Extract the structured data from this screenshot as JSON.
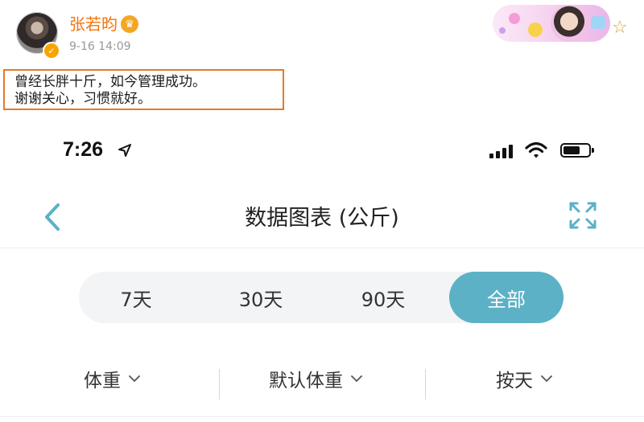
{
  "post": {
    "username": "张若昀",
    "timestamp": "9-16 14:09",
    "text_lines": [
      "曾经长胖十斤，如今管理成功。",
      "谢谢关心，习惯就好。"
    ]
  },
  "status_bar": {
    "time": "7:26"
  },
  "nav": {
    "title": "数据图表 (公斤)"
  },
  "range_tabs": [
    {
      "label": "7天",
      "active": false
    },
    {
      "label": "30天",
      "active": false
    },
    {
      "label": "90天",
      "active": false
    },
    {
      "label": "全部",
      "active": true
    }
  ],
  "filters": [
    {
      "label": "体重"
    },
    {
      "label": "默认体重"
    },
    {
      "label": "按天"
    }
  ],
  "colors": {
    "accent": "#5cb1c6",
    "username": "#f2740c",
    "highlight_border": "#e37a2b"
  },
  "icons": [
    "avatar",
    "verified-icon",
    "crown-icon",
    "star-icon",
    "location-arrow-icon",
    "signal-icon",
    "wifi-icon",
    "battery-icon",
    "back-icon",
    "fullscreen-icon",
    "chevron-down-icon"
  ]
}
